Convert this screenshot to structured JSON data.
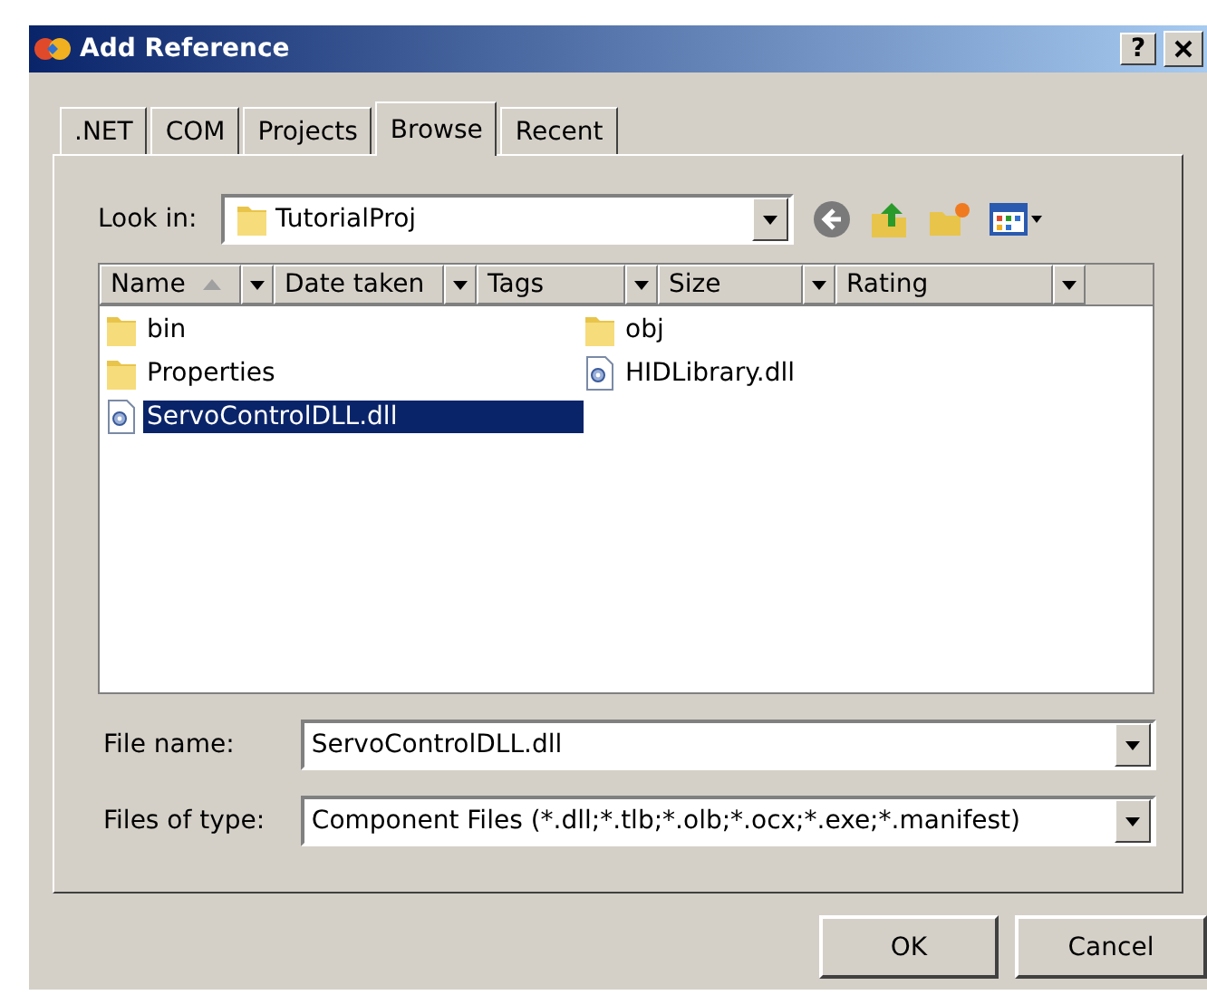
{
  "window": {
    "title": "Add Reference",
    "help": "?"
  },
  "tabs": [
    {
      "label": ".NET",
      "selected": false
    },
    {
      "label": "COM",
      "selected": false
    },
    {
      "label": "Projects",
      "selected": false
    },
    {
      "label": "Browse",
      "selected": true
    },
    {
      "label": "Recent",
      "selected": false
    }
  ],
  "look_in": {
    "label": "Look in:",
    "value": "TutorialProj"
  },
  "columns": [
    {
      "label": "Name",
      "sorted": true
    },
    {
      "label": "Date taken",
      "sorted": false
    },
    {
      "label": "Tags",
      "sorted": false
    },
    {
      "label": "Size",
      "sorted": false
    },
    {
      "label": "Rating",
      "sorted": false
    }
  ],
  "files": [
    {
      "name": "bin",
      "kind": "folder",
      "selected": false
    },
    {
      "name": "Properties",
      "kind": "folder",
      "selected": false
    },
    {
      "name": "ServoControlDLL.dll",
      "kind": "dll",
      "selected": true
    },
    {
      "name": "obj",
      "kind": "folder",
      "selected": false
    },
    {
      "name": "HIDLibrary.dll",
      "kind": "dll",
      "selected": false
    }
  ],
  "file_name": {
    "label": "File name:",
    "value": "ServoControlDLL.dll"
  },
  "file_type": {
    "label": "Files of type:",
    "value": "Component Files (*.dll;*.tlb;*.olb;*.ocx;*.exe;*.manifest)"
  },
  "buttons": [
    "OK",
    "Cancel"
  ]
}
